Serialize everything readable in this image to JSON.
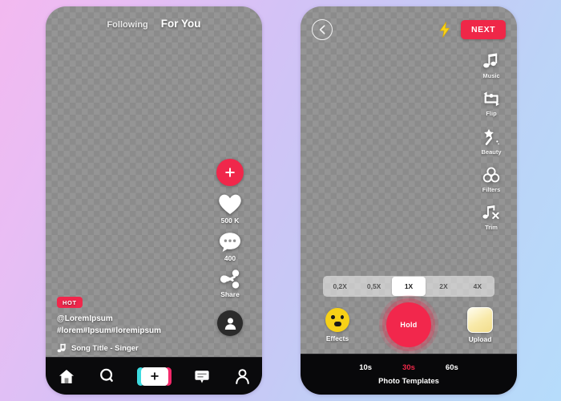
{
  "background": {
    "gradient_from": "#f3b9f0",
    "gradient_to": "#b6dcfb"
  },
  "accent": {
    "red": "#f0274b",
    "next_red": "#ef2748",
    "record_red": "#f2274c",
    "yellow": "#f7d117",
    "cyan": "#3ddbe0",
    "pink": "#f4286a"
  },
  "feed_screen": {
    "name": "For You feed",
    "tabs": [
      {
        "label": "Following",
        "active": false
      },
      {
        "label": "For You",
        "active": true
      }
    ],
    "actions": {
      "follow_icon": "plus-icon",
      "like": {
        "icon": "heart-icon",
        "count": "500 K"
      },
      "comment": {
        "icon": "comment-icon",
        "count": "400"
      },
      "share": {
        "icon": "share-icon",
        "label": "Share"
      },
      "avatar_icon": "person-icon"
    },
    "caption": {
      "badge": "HOT",
      "handle": "@LoremIpsum",
      "hashtags": "#lorem#Ipsum#loremipsum",
      "music_icon": "music-note-icon",
      "song": "Song Title - Singer"
    },
    "bottom_nav": [
      {
        "icon": "home-icon",
        "name": "home"
      },
      {
        "icon": "search-icon",
        "name": "discover"
      },
      {
        "icon": "plus-icon",
        "name": "create"
      },
      {
        "icon": "inbox-icon",
        "name": "inbox"
      },
      {
        "icon": "person-icon",
        "name": "profile"
      }
    ]
  },
  "camera_screen": {
    "name": "Camera capture",
    "top_bar": {
      "back_icon": "chevron-left-icon",
      "flash_icon": "lightning-bolt-icon",
      "next_label": "NEXT"
    },
    "tools": [
      {
        "icon": "music-note-icon",
        "label": "Music"
      },
      {
        "icon": "camera-flip-icon",
        "label": "Flip"
      },
      {
        "icon": "magic-wand-icon",
        "label": "Beauty"
      },
      {
        "icon": "filters-circles-icon",
        "label": "Filters"
      },
      {
        "icon": "music-note-x-icon",
        "label": "Trim"
      }
    ],
    "speeds": [
      {
        "label": "0,2X",
        "active": false
      },
      {
        "label": "0,5X",
        "active": false
      },
      {
        "label": "1X",
        "active": true
      },
      {
        "label": "2X",
        "active": false
      },
      {
        "label": "4X",
        "active": false
      }
    ],
    "capture": {
      "effects_icon": "smiley-face-icon",
      "effects_label": "Effects",
      "record_label": "Hold",
      "upload_icon": "photo-thumbnail-icon",
      "upload_label": "Upload"
    },
    "bottom_bar": {
      "durations": [
        {
          "label": "10s",
          "active": false
        },
        {
          "label": "30s",
          "active": true
        },
        {
          "label": "60s",
          "active": false
        }
      ],
      "templates_label": "Photo Templates"
    }
  }
}
